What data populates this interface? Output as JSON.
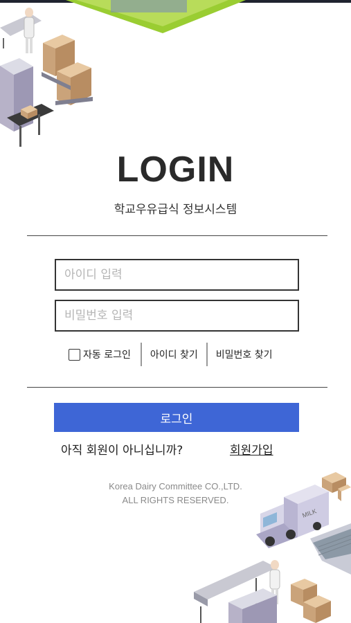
{
  "header": {
    "title": "LOGIN",
    "subtitle": "학교우유급식 정보시스템"
  },
  "form": {
    "id_placeholder": "아이디 입력",
    "pw_placeholder": "비밀번호 입력",
    "auto_login_label": "자동 로그인",
    "find_id_label": "아이디 찾기",
    "find_pw_label": "비밀번호 찾기",
    "login_button_label": "로그인"
  },
  "signup": {
    "question": "아직 회원이 아니십니까?",
    "link_label": "회원가입"
  },
  "footer": {
    "line1": "Korea Dairy Committee CO.,LTD.",
    "line2": "ALL RIGHTS RESERVED."
  },
  "illustration": {
    "truck_label": "MILK"
  },
  "colors": {
    "accent": "#3e66d6",
    "grass": "#9acd32"
  }
}
